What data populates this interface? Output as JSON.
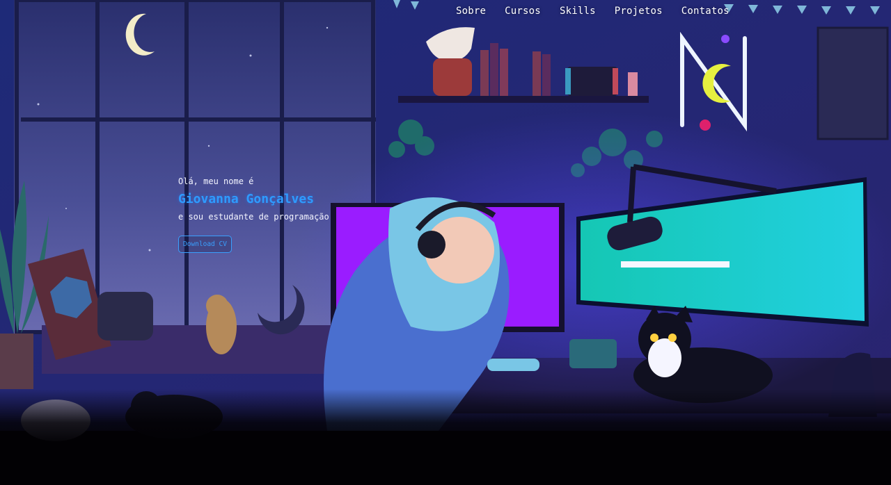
{
  "nav": {
    "items": [
      {
        "label": "Sobre"
      },
      {
        "label": "Cursos"
      },
      {
        "label": "Skills"
      },
      {
        "label": "Projetos"
      },
      {
        "label": "Contatos"
      }
    ]
  },
  "hero": {
    "greeting": "Olá, meu nome é",
    "name": "Giovanna Gonçalves",
    "tagline": "e sou estudante de programação",
    "cv_button": "Download CV"
  },
  "colors": {
    "accent": "#2e9bff",
    "nav_text": "#ffffff",
    "background": "#020104"
  }
}
